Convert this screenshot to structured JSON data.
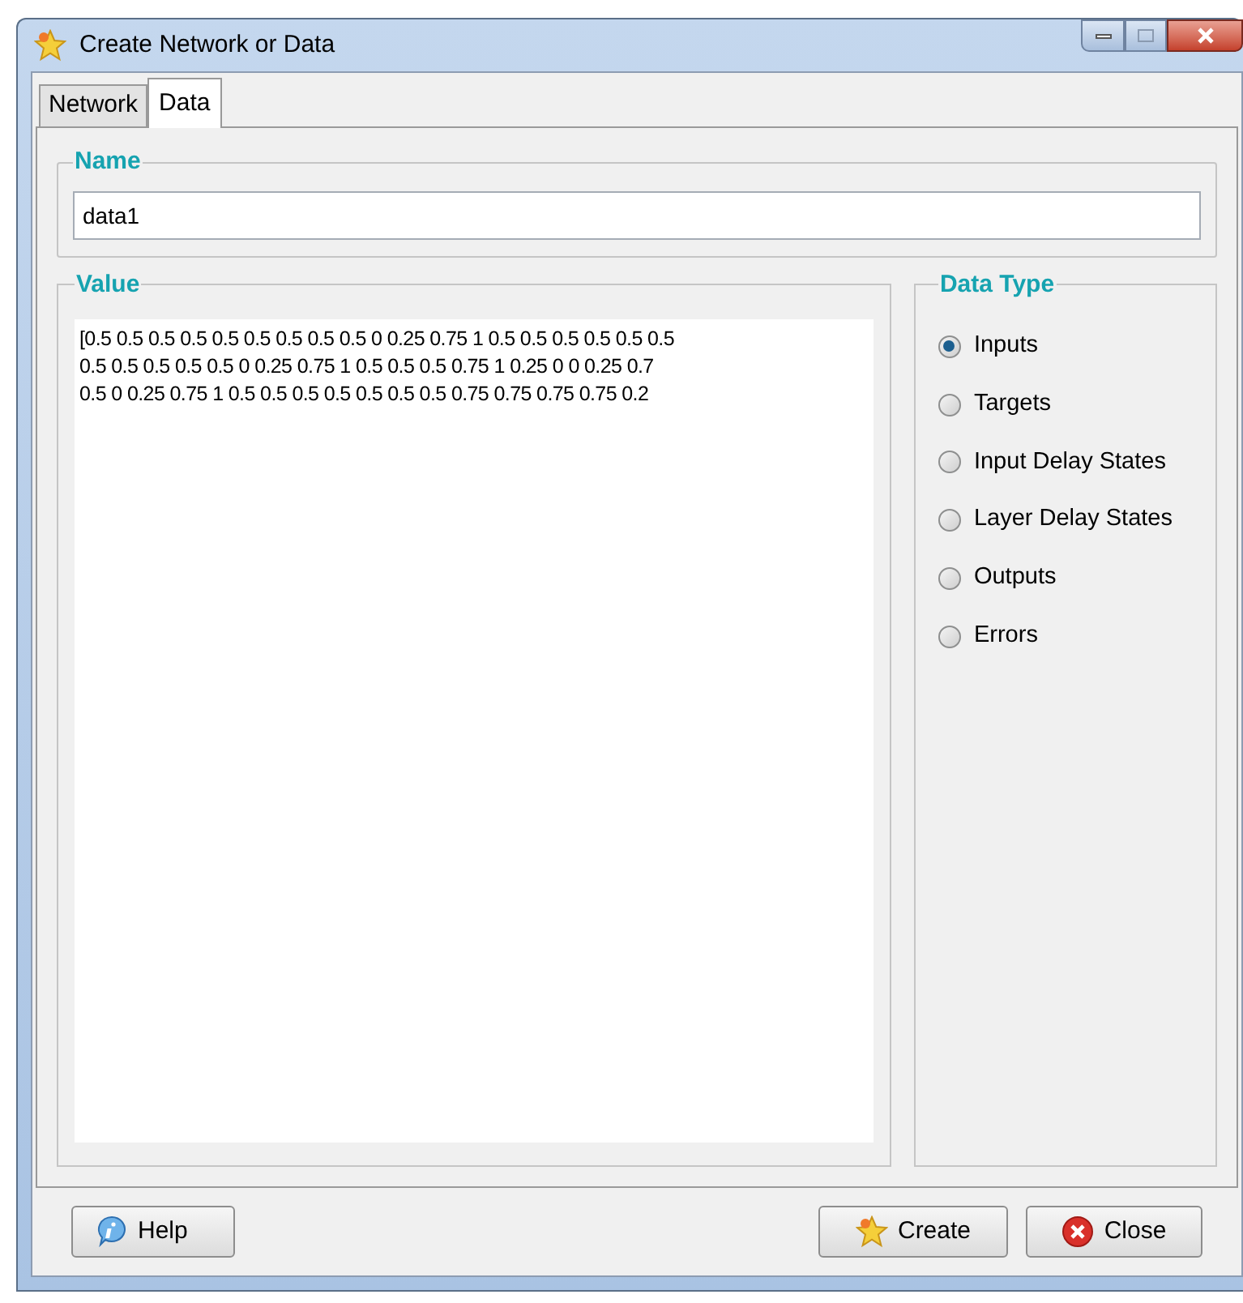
{
  "window": {
    "title": "Create Network or Data"
  },
  "tabs": [
    {
      "label": "Network",
      "selected": false
    },
    {
      "label": "Data",
      "selected": true
    }
  ],
  "name_group": {
    "title": "Name",
    "value": "data1"
  },
  "value_group": {
    "title": "Value",
    "lines": [
      "[0.5 0.5 0.5 0.5 0.5 0.5 0.5 0.5 0.5 0 0.25 0.75 1 0.5 0.5 0.5 0.5 0.5 0.5",
      "0.5 0.5 0.5 0.5 0.5 0 0.25 0.75 1 0.5 0.5 0.5 0.75 1 0.25 0 0 0.25 0.7",
      "0.5 0 0.25 0.75 1 0.5 0.5 0.5 0.5 0.5 0.5 0.5 0.75 0.75 0.75 0.75 0.2"
    ]
  },
  "data_type": {
    "title": "Data Type",
    "options": [
      {
        "label": "Inputs",
        "selected": true
      },
      {
        "label": "Targets",
        "selected": false
      },
      {
        "label": "Input Delay States",
        "selected": false
      },
      {
        "label": "Layer Delay States",
        "selected": false
      },
      {
        "label": "Outputs",
        "selected": false
      },
      {
        "label": "Errors",
        "selected": false
      }
    ]
  },
  "buttons": [
    {
      "label": "Help",
      "kind": "help"
    },
    {
      "label": "Create",
      "kind": "create"
    },
    {
      "label": "Close",
      "kind": "close"
    }
  ]
}
